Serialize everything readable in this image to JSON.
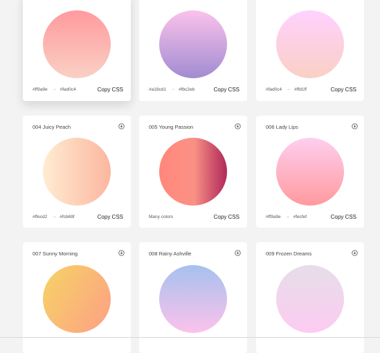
{
  "cards": [
    {
      "title": "",
      "colors": [
        "#ff9a9e",
        "#fad0c4"
      ],
      "direction": "to bottom",
      "footer_text": "",
      "copy_label": "Copy CSS"
    },
    {
      "title": "",
      "colors": [
        "#a18cd1",
        "#fbc2eb"
      ],
      "direction": "to top",
      "footer_text": "",
      "copy_label": "Copy CSS"
    },
    {
      "title": "",
      "colors": [
        "#fad0c4",
        "#ffd1ff"
      ],
      "direction": "to top",
      "footer_text": "",
      "copy_label": "Copy CSS"
    },
    {
      "title": "004 Juicy Peach",
      "colors": [
        "#ffecd2",
        "#fcb69f"
      ],
      "direction": "to right",
      "footer_text": "",
      "copy_label": "Copy CSS"
    },
    {
      "title": "005 Young Passion",
      "colors": [
        "#ff8177",
        "#ff867a",
        "#ff8c7f",
        "#f99185",
        "#cf556c",
        "#b12a5b"
      ],
      "stops": [
        "0%",
        "0%",
        "21%",
        "52%",
        "78%",
        "100%"
      ],
      "direction": "to right",
      "footer_text": "Many colors",
      "copy_label": "Copy CSS"
    },
    {
      "title": "006 Lady Lips",
      "colors": [
        "#ff9a9e",
        "#fecfef"
      ],
      "direction": "to top",
      "footer_text": "",
      "copy_label": "Copy CSS"
    },
    {
      "title": "007 Sunny Morning",
      "colors": [
        "#f6d365",
        "#fda085"
      ],
      "direction": "120deg",
      "footer_text": "",
      "copy_label": ""
    },
    {
      "title": "008 Rainy Ashville",
      "colors": [
        "#fbc2eb",
        "#a6c1ee"
      ],
      "direction": "to top",
      "footer_text": "",
      "copy_label": ""
    },
    {
      "title": "009 Frozen Dreams",
      "colors": [
        "#fdcbf1",
        "#e6dee9"
      ],
      "direction": "to top",
      "footer_text": "",
      "copy_label": ""
    }
  ],
  "arrow": "→",
  "icons": {
    "download": "download-circle-icon"
  }
}
